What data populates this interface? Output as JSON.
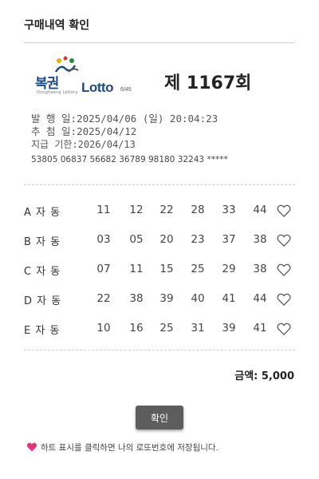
{
  "header": {
    "title": "구매내역 확인"
  },
  "ticket": {
    "logo": {
      "brand": "복권",
      "brand_sub": "Donghaeng Lottery",
      "product": "Lotto",
      "product_sub": "6/45"
    },
    "round": "제 1167회",
    "issue_date": "발 행 일:2025/04/06 (일) 20:04:23",
    "draw_date": "추 첨 일:2025/04/12",
    "payment_deadline": "지급 기한:2026/04/13",
    "serial": "53805 06837 56682 36789 98180 32243 *****",
    "games": [
      {
        "label": "A 자  동",
        "numbers": [
          "11",
          "12",
          "22",
          "28",
          "33",
          "44"
        ]
      },
      {
        "label": "B 자  동",
        "numbers": [
          "03",
          "05",
          "20",
          "23",
          "37",
          "38"
        ]
      },
      {
        "label": "C 자  동",
        "numbers": [
          "07",
          "11",
          "15",
          "25",
          "29",
          "38"
        ]
      },
      {
        "label": "D 자  동",
        "numbers": [
          "22",
          "38",
          "39",
          "40",
          "41",
          "44"
        ]
      },
      {
        "label": "E 자  동",
        "numbers": [
          "10",
          "16",
          "25",
          "31",
          "39",
          "41"
        ]
      }
    ],
    "total": "금액: 5,000"
  },
  "confirm_button": {
    "label": "확인"
  },
  "notice": {
    "text": "하트 표시를 클릭하면 나의 로또번호에 저장됩니다."
  },
  "icons": {
    "save_heart": "heart-outline-icon",
    "notice_heart": "heart-filled-icon"
  },
  "colors": {
    "heart_filled": "#e8337a",
    "button": "#5d5d5d",
    "logo_blue": "#1d4a8a"
  }
}
